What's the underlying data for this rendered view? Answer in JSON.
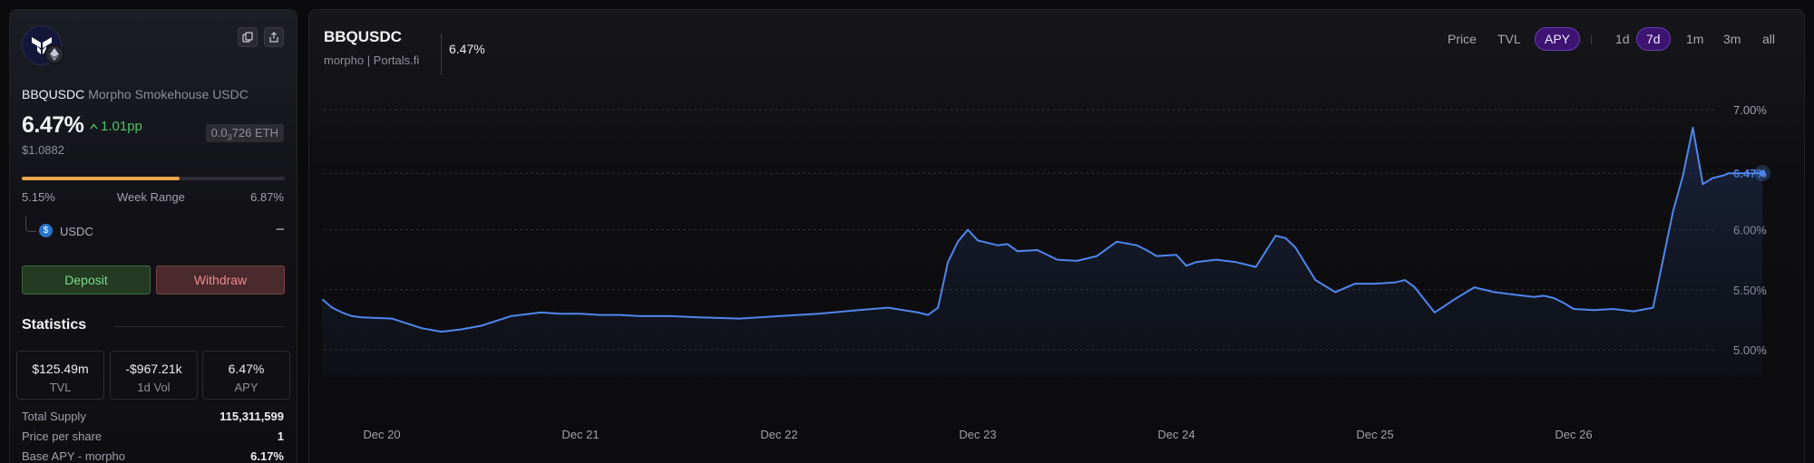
{
  "asset": {
    "symbol": "BBQUSDC",
    "name": "Morpho Smokehouse USDC",
    "apy": "6.47%",
    "apy_change": "1.01pp",
    "eth_price_prefix": "0.0",
    "eth_price_sub": "3",
    "eth_price_suffix": "726 ETH",
    "usd_price": "$1.0882"
  },
  "week_range": {
    "low": "5.15%",
    "label": "Week Range",
    "high": "6.87%",
    "position_fraction": 0.6
  },
  "underlying": {
    "token": "USDC",
    "value": "–"
  },
  "actions": {
    "deposit": "Deposit",
    "withdraw": "Withdraw"
  },
  "statistics": {
    "heading": "Statistics",
    "cards": [
      {
        "value": "$125.49m",
        "label": "TVL"
      },
      {
        "value": "-$967.21k",
        "label": "1d Vol"
      },
      {
        "value": "6.47%",
        "label": "APY"
      }
    ],
    "rows": [
      {
        "label": "Total Supply",
        "value": "115,311,599"
      },
      {
        "label": "Price per share",
        "value": "1"
      },
      {
        "label": "Base APY - morpho",
        "value": "6.17%"
      }
    ]
  },
  "chart_header": {
    "title": "BBQUSDC",
    "subtitle": "morpho | Portals.fi",
    "current": "6.47%"
  },
  "metric_tabs": [
    {
      "label": "Price",
      "active": false
    },
    {
      "label": "TVL",
      "active": false
    },
    {
      "label": "APY",
      "active": true
    }
  ],
  "range_tabs": [
    {
      "label": "1d",
      "active": false
    },
    {
      "label": "7d",
      "active": true
    },
    {
      "label": "1m",
      "active": false
    },
    {
      "label": "3m",
      "active": false
    },
    {
      "label": "all",
      "active": false
    }
  ],
  "colors": {
    "line": "#4f86ee",
    "positive": "#4ec06b",
    "range_fill": "#e9a64d",
    "active_tab": "#3d1472"
  },
  "chart_data": {
    "type": "area",
    "title": "",
    "xlabel": "",
    "ylabel": "",
    "x_ticks": [
      "Dec 20",
      "Dec 21",
      "Dec 22",
      "Dec 23",
      "Dec 24",
      "Dec 25",
      "Dec 26"
    ],
    "y_ticks": [
      "5.00%",
      "5.50%",
      "6.00%",
      "6.47%",
      "7.00%"
    ],
    "y_tick_values": [
      5.0,
      5.5,
      6.0,
      6.47,
      7.0
    ],
    "ylim": [
      5.0,
      7.0
    ],
    "x_range_days": [
      -0.3,
      6.95
    ],
    "current_value": 6.47,
    "series": [
      {
        "x": [
          -0.3,
          -0.25,
          -0.2,
          -0.15,
          -0.1,
          0.05,
          0.2,
          0.3,
          0.4,
          0.5,
          0.65,
          0.8,
          0.9,
          1.0,
          1.1,
          1.2,
          1.3,
          1.45,
          1.6,
          1.8,
          2.0,
          2.2,
          2.4,
          2.55,
          2.7,
          2.75,
          2.8,
          2.85,
          2.9,
          2.95,
          3.0,
          3.1,
          3.15,
          3.2,
          3.3,
          3.4,
          3.5,
          3.6,
          3.7,
          3.8,
          3.85,
          3.9,
          4.0,
          4.05,
          4.1,
          4.2,
          4.3,
          4.4,
          4.5,
          4.55,
          4.6,
          4.7,
          4.8,
          4.9,
          5.0,
          5.1,
          5.15,
          5.2,
          5.3,
          5.4,
          5.5,
          5.6,
          5.65,
          5.7,
          5.8,
          5.85,
          5.9,
          5.95,
          6.0,
          6.1,
          6.2,
          6.3,
          6.4,
          6.5,
          6.55,
          6.6,
          6.65,
          6.7,
          6.75,
          6.78,
          6.8,
          6.85,
          6.9,
          6.95
        ],
        "y": [
          5.42,
          5.35,
          5.31,
          5.28,
          5.27,
          5.26,
          5.18,
          5.15,
          5.17,
          5.2,
          5.28,
          5.31,
          5.3,
          5.3,
          5.29,
          5.29,
          5.28,
          5.28,
          5.27,
          5.26,
          5.28,
          5.3,
          5.33,
          5.35,
          5.31,
          5.29,
          5.35,
          5.73,
          5.9,
          6.0,
          5.91,
          5.87,
          5.88,
          5.82,
          5.83,
          5.75,
          5.74,
          5.78,
          5.9,
          5.87,
          5.83,
          5.78,
          5.79,
          5.7,
          5.73,
          5.75,
          5.73,
          5.69,
          5.95,
          5.93,
          5.85,
          5.58,
          5.48,
          5.55,
          5.55,
          5.56,
          5.58,
          5.52,
          5.31,
          5.42,
          5.52,
          5.48,
          5.47,
          5.46,
          5.44,
          5.45,
          5.43,
          5.39,
          5.34,
          5.33,
          5.34,
          5.32,
          5.35,
          6.15,
          6.45,
          6.85,
          6.38,
          6.43,
          6.45,
          6.47,
          6.47,
          6.47,
          6.47,
          6.47
        ]
      }
    ]
  }
}
